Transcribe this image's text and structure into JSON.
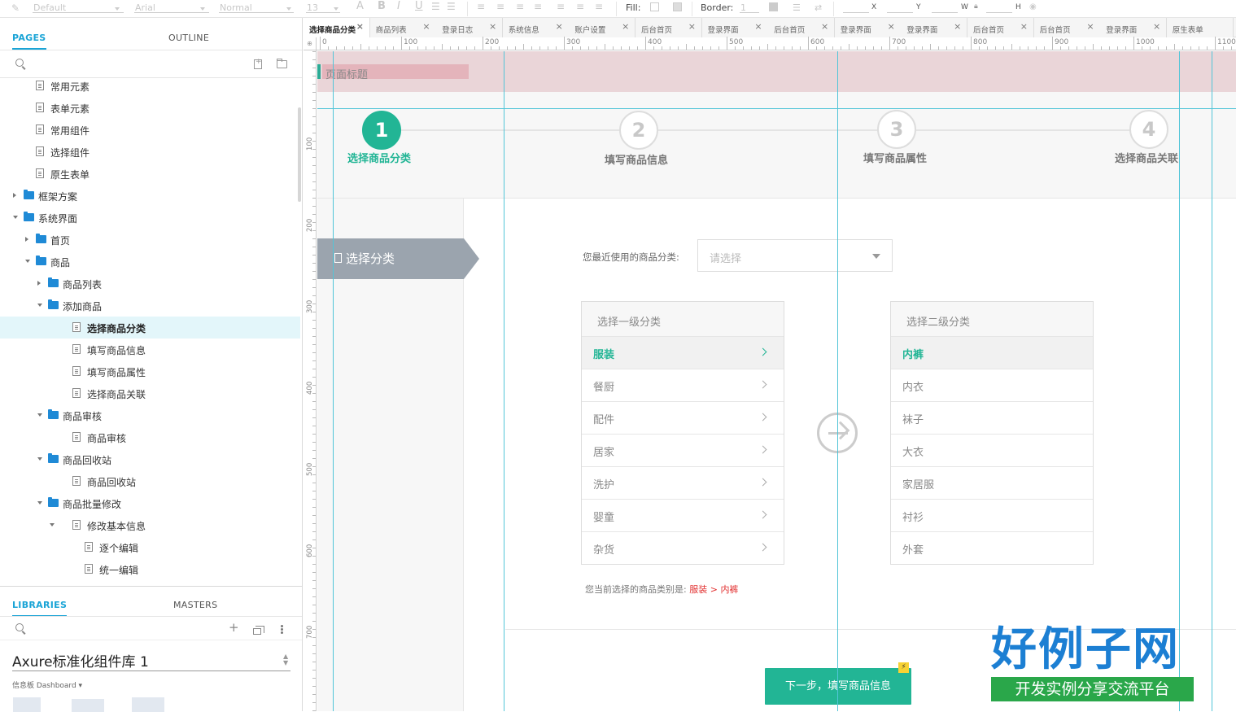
{
  "toolbar": {
    "style_default": "Default",
    "font": "Arial",
    "weight": "Normal",
    "size": "13",
    "fill_label": "Fill:",
    "border_label": "Border:",
    "border_value": "1",
    "x_label": "X",
    "y_label": "Y",
    "w_label": "W",
    "h_label": "H"
  },
  "left_panel": {
    "pages_tab": "PAGES",
    "outline_tab": "OUTLINE",
    "libraries_tab": "LIBRARIES",
    "masters_tab": "MASTERS",
    "library_name": "Axure标准化组件库 1",
    "library_category": "信息板 Dashboard ▾"
  },
  "tree": [
    {
      "label": "常用元素",
      "type": "page",
      "indent": 0
    },
    {
      "label": "表单元素",
      "type": "page",
      "indent": 0
    },
    {
      "label": "常用组件",
      "type": "page",
      "indent": 0
    },
    {
      "label": "选择组件",
      "type": "page",
      "indent": 0
    },
    {
      "label": "原生表单",
      "type": "page",
      "indent": 0
    },
    {
      "label": "框架方案",
      "type": "folder",
      "indent": 0,
      "expanded": false
    },
    {
      "label": "系统界面",
      "type": "folder",
      "indent": 0,
      "expanded": true
    },
    {
      "label": "首页",
      "type": "folder",
      "indent": 1,
      "expanded": false
    },
    {
      "label": "商品",
      "type": "folder",
      "indent": 1,
      "expanded": true
    },
    {
      "label": "商品列表",
      "type": "folder",
      "indent": 2,
      "expanded": false
    },
    {
      "label": "添加商品",
      "type": "folder",
      "indent": 2,
      "expanded": true
    },
    {
      "label": "选择商品分类",
      "type": "page",
      "indent": 3,
      "selected": true
    },
    {
      "label": "填写商品信息",
      "type": "page",
      "indent": 3
    },
    {
      "label": "填写商品属性",
      "type": "page",
      "indent": 3
    },
    {
      "label": "选择商品关联",
      "type": "page",
      "indent": 3
    },
    {
      "label": "商品审核",
      "type": "folder",
      "indent": 2,
      "expanded": true
    },
    {
      "label": "商品审核",
      "type": "page",
      "indent": 3
    },
    {
      "label": "商品回收站",
      "type": "folder",
      "indent": 2,
      "expanded": true
    },
    {
      "label": "商品回收站",
      "type": "page",
      "indent": 3
    },
    {
      "label": "商品批量修改",
      "type": "folder",
      "indent": 2,
      "expanded": true
    },
    {
      "label": "修改基本信息",
      "type": "page",
      "indent": 3,
      "expanded": true
    },
    {
      "label": "逐个编辑",
      "type": "page",
      "indent": 4
    },
    {
      "label": "统一编辑",
      "type": "page",
      "indent": 4
    }
  ],
  "tabs": [
    {
      "label": "选择商品分类",
      "active": true
    },
    {
      "label": "商品列表"
    },
    {
      "label": "登录日志"
    },
    {
      "label": "系统信息"
    },
    {
      "label": "账户设置"
    },
    {
      "label": "后台首页"
    },
    {
      "label": "登录界面"
    },
    {
      "label": "后台首页"
    },
    {
      "label": "登录界面"
    },
    {
      "label": "登录界面"
    },
    {
      "label": "后台首页"
    },
    {
      "label": "后台首页"
    },
    {
      "label": "登录界面"
    },
    {
      "label": "原生表单"
    }
  ],
  "ruler": {
    "h_labels": [
      "0",
      "100",
      "200",
      "300",
      "400",
      "500",
      "600",
      "700",
      "800",
      "900",
      "1000",
      "1100"
    ],
    "v_labels": [
      "100",
      "200",
      "300",
      "400",
      "500",
      "600",
      "700"
    ]
  },
  "design": {
    "page_title": "页面标题",
    "steps": [
      {
        "num": "1",
        "label": "选择商品分类",
        "active": true
      },
      {
        "num": "2",
        "label": "填写商品信息"
      },
      {
        "num": "3",
        "label": "填写商品属性"
      },
      {
        "num": "4",
        "label": "选择商品关联"
      }
    ],
    "left_badge": "选择分类",
    "recent_label": "您最近使用的商品分类:",
    "recent_placeholder": "请选择",
    "level1": {
      "header": "选择一级分类",
      "items": [
        {
          "label": "服装",
          "selected": true
        },
        {
          "label": "餐厨"
        },
        {
          "label": "配件"
        },
        {
          "label": "居家"
        },
        {
          "label": "洗护"
        },
        {
          "label": "婴童"
        },
        {
          "label": "杂货"
        }
      ]
    },
    "level2": {
      "header": "选择二级分类",
      "items": [
        {
          "label": "内裤",
          "selected": true
        },
        {
          "label": "内衣"
        },
        {
          "label": "袜子"
        },
        {
          "label": "大衣"
        },
        {
          "label": "家居服"
        },
        {
          "label": "衬衫"
        },
        {
          "label": "外套"
        }
      ]
    },
    "selection_prefix": "您当前选择的商品类别是:",
    "selection_cat1": "服装",
    "selection_sep": ">",
    "selection_cat2": "内裤",
    "next_button": "下一步，填写商品信息"
  },
  "watermark": {
    "main": "好例子网",
    "sub": "开发实例分享交流平台"
  },
  "colors": {
    "accent": "#22b595",
    "link": "#1aa4d6",
    "folder": "#1f8ad6",
    "guide": "#52c5d8",
    "title_band": "#ead5d8",
    "selection_red": "#e23030"
  }
}
